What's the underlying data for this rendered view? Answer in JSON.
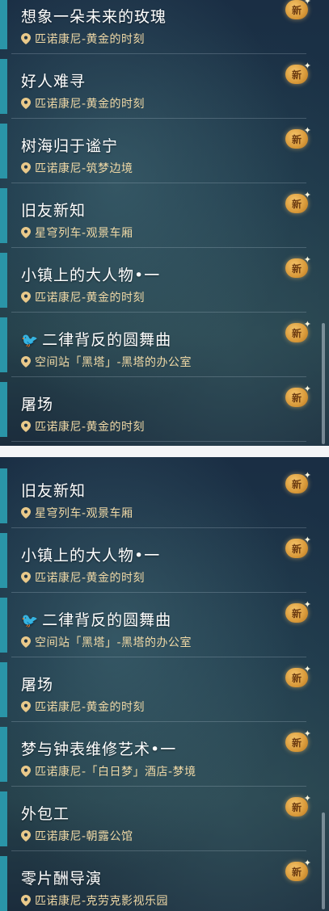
{
  "badge_label": "新",
  "screens": [
    {
      "items": [
        {
          "title": "想象一朵未来的玫瑰",
          "location": "匹诺康尼-黄金的时刻"
        },
        {
          "title": "好人难寻",
          "location": "匹诺康尼-黄金的时刻"
        },
        {
          "title": "树海归于谧宁",
          "location": "匹诺康尼-筑梦边境"
        },
        {
          "title": "旧友新知",
          "location": "星穹列车-观景车厢"
        },
        {
          "title": "小镇上的大人物•一",
          "location": "匹诺康尼-黄金的时刻"
        },
        {
          "title": "二律背反的圆舞曲",
          "location": "空间站「黑塔」-黑塔的办公室",
          "icon": "bird-icon"
        },
        {
          "title": "屠场",
          "location": "匹诺康尼-黄金的时刻"
        }
      ]
    },
    {
      "items": [
        {
          "title": "旧友新知",
          "location": "星穹列车-观景车厢"
        },
        {
          "title": "小镇上的大人物•一",
          "location": "匹诺康尼-黄金的时刻"
        },
        {
          "title": "二律背反的圆舞曲",
          "location": "空间站「黑塔」-黑塔的办公室",
          "icon": "bird-icon"
        },
        {
          "title": "屠场",
          "location": "匹诺康尼-黄金的时刻"
        },
        {
          "title": "梦与钟表维修艺术•一",
          "location": "匹诺康尼-「白日梦」酒店-梦境"
        },
        {
          "title": "外包工",
          "location": "匹诺康尼-朝露公馆"
        },
        {
          "title": "零片酬导演",
          "location": "匹诺康尼-克劳克影视乐园"
        }
      ]
    }
  ]
}
